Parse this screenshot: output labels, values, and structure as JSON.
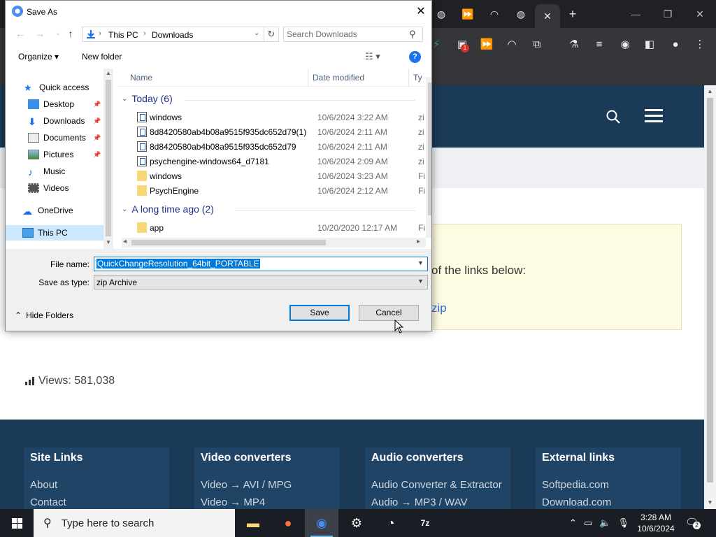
{
  "browser": {
    "tabs": [
      "tab",
      "tab",
      "tab",
      "tab"
    ],
    "new_tab": "+"
  },
  "site": {
    "notice_text": "of the links below:",
    "notice_link": "zip",
    "views_label": "Views: 581,038",
    "footer": [
      {
        "heading": "Site Links",
        "links": [
          "About",
          "Contact"
        ]
      },
      {
        "heading": "Video converters",
        "links": [
          "Video → AVI / MPG",
          "Video → MP4"
        ]
      },
      {
        "heading": "Audio converters",
        "links": [
          "Audio Converter & Extractor",
          "Audio → MP3 / WAV"
        ]
      },
      {
        "heading": "External links",
        "links": [
          "Softpedia.com",
          "Download.com"
        ]
      }
    ]
  },
  "dialog": {
    "title": "Save As",
    "address": {
      "crumbs": [
        "This PC",
        "Downloads"
      ]
    },
    "search_placeholder": "Search Downloads",
    "toolbar": {
      "organize": "Organize ▾",
      "new_folder": "New folder",
      "help": "?"
    },
    "nav_items": [
      {
        "label": "Quick access",
        "icon": "star-icon",
        "pinned": false,
        "selected": false
      },
      {
        "label": "Desktop",
        "icon": "desktop-icon",
        "pinned": true,
        "selected": false
      },
      {
        "label": "Downloads",
        "icon": "download-icon",
        "pinned": true,
        "selected": false
      },
      {
        "label": "Documents",
        "icon": "documents-icon",
        "pinned": true,
        "selected": false
      },
      {
        "label": "Pictures",
        "icon": "pictures-icon",
        "pinned": true,
        "selected": false
      },
      {
        "label": "Music",
        "icon": "music-icon",
        "pinned": false,
        "selected": false
      },
      {
        "label": "Videos",
        "icon": "videos-icon",
        "pinned": false,
        "selected": false
      },
      {
        "label": "OneDrive",
        "icon": "cloud-icon",
        "pinned": false,
        "selected": false
      },
      {
        "label": "This PC",
        "icon": "computer-icon",
        "pinned": false,
        "selected": true
      }
    ],
    "columns": {
      "name": "Name",
      "date": "Date modified",
      "type": "Ty"
    },
    "groups": [
      {
        "label": "Today (6)",
        "files": [
          {
            "name": "windows",
            "date": "10/6/2024 3:22 AM",
            "type": "zi",
            "kind": "zip"
          },
          {
            "name": "8d8420580ab4b08a9515f935dc652d79(1)",
            "date": "10/6/2024 2:11 AM",
            "type": "zi",
            "kind": "zip"
          },
          {
            "name": "8d8420580ab4b08a9515f935dc652d79",
            "date": "10/6/2024 2:11 AM",
            "type": "zi",
            "kind": "zip"
          },
          {
            "name": "psychengine-windows64_d7181",
            "date": "10/6/2024 2:09 AM",
            "type": "zi",
            "kind": "zip"
          },
          {
            "name": "windows",
            "date": "10/6/2024 3:23 AM",
            "type": "Fi",
            "kind": "folder"
          },
          {
            "name": "PsychEngine",
            "date": "10/6/2024 2:12 AM",
            "type": "Fi",
            "kind": "folder"
          }
        ]
      },
      {
        "label": "A long time ago (2)",
        "files": [
          {
            "name": "app",
            "date": "10/20/2020 12:17 AM",
            "type": "Fi",
            "kind": "folder"
          }
        ]
      }
    ],
    "file_name_label": "File name:",
    "file_name_value": "QuickChangeResolution_64bit_PORTABLE",
    "save_type_label": "Save as type:",
    "save_type_value": "zip Archive",
    "hide_folders": "Hide Folders",
    "save_button": "Save",
    "cancel_button": "Cancel"
  },
  "taskbar": {
    "search_placeholder": "Type here to search",
    "time": "3:28 AM",
    "date": "10/6/2024",
    "notification_count": "2"
  },
  "colors": {
    "site_header": "#1b3a57",
    "accent": "#0078d7",
    "notice_bg": "#fdfbe1"
  }
}
